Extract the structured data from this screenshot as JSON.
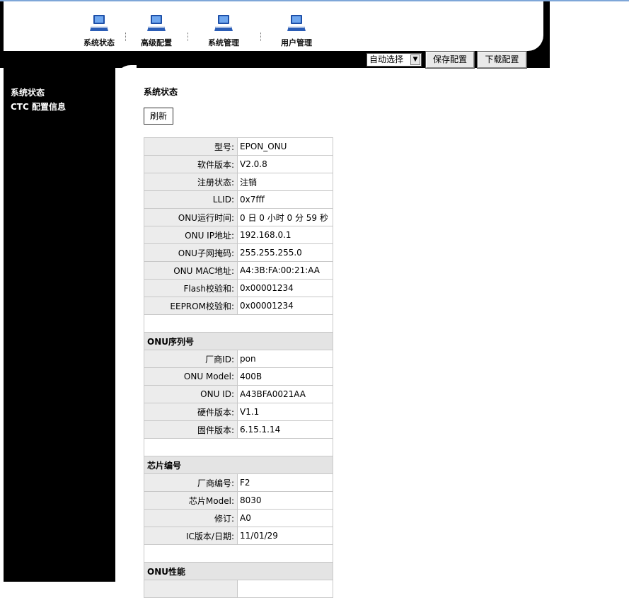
{
  "nav": [
    {
      "label": "系统状态",
      "icon": "computer-icon"
    },
    {
      "label": "高级配置",
      "icon": "computer-icon"
    },
    {
      "label": "系统管理",
      "icon": "computer-icon"
    },
    {
      "label": "用户管理",
      "icon": "computer-icon"
    }
  ],
  "toolbar": {
    "select_value": "自动选择",
    "save_label": "保存配置",
    "download_label": "下载配置"
  },
  "sidebar": {
    "items": [
      "系统状态",
      "CTC 配置信息"
    ]
  },
  "main": {
    "title": "系统状态",
    "refresh_label": "刷新",
    "basic": [
      {
        "k": "型号:",
        "v": "EPON_ONU"
      },
      {
        "k": "软件版本:",
        "v": "V2.0.8"
      },
      {
        "k": "注册状态:",
        "v": "注销"
      },
      {
        "k": "LLID:",
        "v": "0x7fff"
      },
      {
        "k": "ONU运行时间:",
        "v": "0 日 0 小时 0 分 59 秒"
      },
      {
        "k": "ONU IP地址:",
        "v": "192.168.0.1"
      },
      {
        "k": "ONU子网掩码:",
        "v": "255.255.255.0"
      },
      {
        "k": "ONU MAC地址:",
        "v": "A4:3B:FA:00:21:AA"
      },
      {
        "k": "Flash校验和:",
        "v": "0x00001234"
      },
      {
        "k": "EEPROM校验和:",
        "v": "0x00001234"
      }
    ],
    "serial_title": "ONU序列号",
    "serial": [
      {
        "k": "厂商ID:",
        "v": "pon"
      },
      {
        "k": "ONU Model:",
        "v": "400B"
      },
      {
        "k": "ONU ID:",
        "v": "A43BFA0021AA"
      },
      {
        "k": "硬件版本:",
        "v": "V1.1"
      },
      {
        "k": "固件版本:",
        "v": "6.15.1.14"
      }
    ],
    "chip_title": "芯片编号",
    "chip": [
      {
        "k": "厂商编号:",
        "v": "F2"
      },
      {
        "k": "芯片Model:",
        "v": "8030"
      },
      {
        "k": "修订:",
        "v": "A0"
      },
      {
        "k": "IC版本/日期:",
        "v": "11/01/29"
      }
    ],
    "perf_title": "ONU性能"
  }
}
